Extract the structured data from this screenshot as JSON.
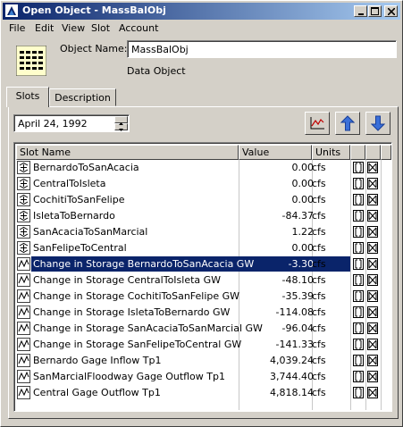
{
  "window": {
    "title": "Open Object - MassBalObj"
  },
  "menu": [
    "File",
    "Edit",
    "View",
    "Slot",
    "Account"
  ],
  "object": {
    "name_label": "Object Name:",
    "name_value": "MassBalObj",
    "type_label": "Data Object"
  },
  "tabs": [
    {
      "label": "Slots",
      "active": true
    },
    {
      "label": "Description",
      "active": false
    }
  ],
  "date": {
    "value": "April 24, 1992"
  },
  "table": {
    "headers": {
      "name": "Slot Name",
      "value": "Value",
      "units": "Units"
    },
    "rows": [
      {
        "icon": "series-slot-icon",
        "name": "BernardoToSanAcacia",
        "value": "0.00",
        "units": "cfs"
      },
      {
        "icon": "series-slot-icon",
        "name": "CentralToIsleta",
        "value": "0.00",
        "units": "cfs"
      },
      {
        "icon": "series-slot-icon",
        "name": "CochitiToSanFelipe",
        "value": "0.00",
        "units": "cfs"
      },
      {
        "icon": "series-slot-icon",
        "name": "IsletaToBernardo",
        "value": "-84.37",
        "units": "cfs"
      },
      {
        "icon": "series-slot-icon",
        "name": "SanAcaciaToSanMarcial",
        "value": "1.22",
        "units": "cfs"
      },
      {
        "icon": "series-slot-icon",
        "name": "SanFelipeToCentral",
        "value": "0.00",
        "units": "cfs"
      },
      {
        "icon": "timeseries-slot-icon",
        "name": "Change in Storage BernardoToSanAcacia GW",
        "value": "-3.30",
        "units": "cfs",
        "selected": true
      },
      {
        "icon": "timeseries-slot-icon",
        "name": "Change in Storage CentralToIsleta GW",
        "value": "-48.10",
        "units": "cfs"
      },
      {
        "icon": "timeseries-slot-icon",
        "name": "Change in Storage CochitiToSanFelipe GW",
        "value": "-35.39",
        "units": "cfs"
      },
      {
        "icon": "timeseries-slot-icon",
        "name": "Change in Storage IsletaToBernardo GW",
        "value": "-114.08",
        "units": "cfs"
      },
      {
        "icon": "timeseries-slot-icon",
        "name": "Change in Storage SanAcaciaToSanMarcial GW",
        "value": "-96.04",
        "units": "cfs"
      },
      {
        "icon": "timeseries-slot-icon",
        "name": "Change in Storage SanFelipeToCentral GW",
        "value": "-141.33",
        "units": "cfs"
      },
      {
        "icon": "timeseries-slot-icon",
        "name": "Bernardo Gage Inflow Tp1",
        "value": "4,039.24",
        "units": "cfs"
      },
      {
        "icon": "timeseries-slot-icon",
        "name": "SanMarcialFloodway Gage Outflow Tp1",
        "value": "3,744.40",
        "units": "cfs"
      },
      {
        "icon": "timeseries-slot-icon",
        "name": "Central Gage Outflow Tp1",
        "value": "4,818.14",
        "units": "cfs"
      }
    ]
  }
}
